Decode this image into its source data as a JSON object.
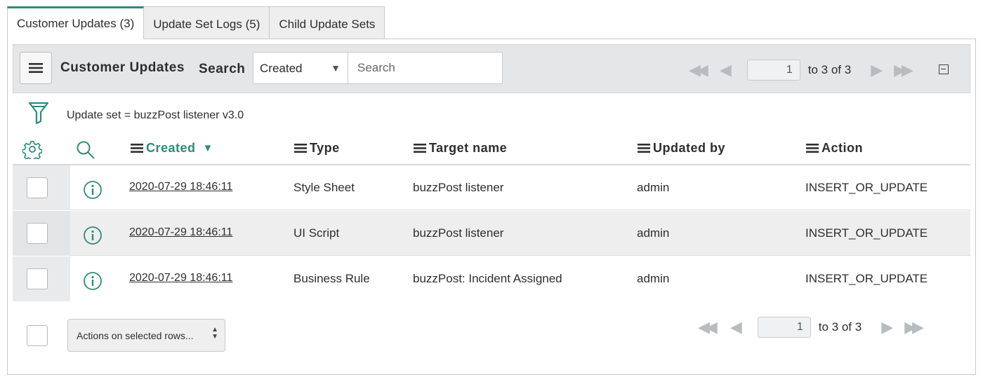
{
  "tabs": [
    {
      "label": "Customer Updates (3)",
      "active": true
    },
    {
      "label": "Update Set Logs (5)",
      "active": false
    },
    {
      "label": "Child Update Sets",
      "active": false
    }
  ],
  "header": {
    "title": "Customer Updates",
    "search_label": "Search",
    "search_field": "Created",
    "search_placeholder": "Search"
  },
  "pager_top": {
    "page": "1",
    "range_text": "to 3 of 3"
  },
  "filter": {
    "breadcrumb": "Update set = buzzPost listener v3.0"
  },
  "columns": [
    {
      "label": "Created",
      "sorted": "desc"
    },
    {
      "label": "Type"
    },
    {
      "label": "Target name"
    },
    {
      "label": "Updated by"
    },
    {
      "label": "Action"
    }
  ],
  "rows": [
    {
      "created": "2020-07-29 18:46:11",
      "type": "Style Sheet",
      "target_name": "buzzPost listener",
      "updated_by": "admin",
      "action": "INSERT_OR_UPDATE"
    },
    {
      "created": "2020-07-29 18:46:11",
      "type": "UI Script",
      "target_name": "buzzPost listener",
      "updated_by": "admin",
      "action": "INSERT_OR_UPDATE"
    },
    {
      "created": "2020-07-29 18:46:11",
      "type": "Business Rule",
      "target_name": "buzzPost: Incident Assigned",
      "updated_by": "admin",
      "action": "INSERT_OR_UPDATE"
    }
  ],
  "footer": {
    "actions_label": "Actions on selected rows..."
  },
  "pager_bottom": {
    "page": "1",
    "range_text": "to 3 of 3"
  },
  "colors": {
    "accent": "#2e8b7a",
    "header_bg": "#e4e6e8",
    "row_alt_bg": "#eeeeee"
  },
  "icons": [
    "list-menu-icon",
    "filter-funnel-icon",
    "gear-icon",
    "search-icon",
    "info-icon",
    "first-page-icon",
    "prev-page-icon",
    "next-page-icon",
    "last-page-icon",
    "collapse-icon",
    "sort-down-icon"
  ]
}
